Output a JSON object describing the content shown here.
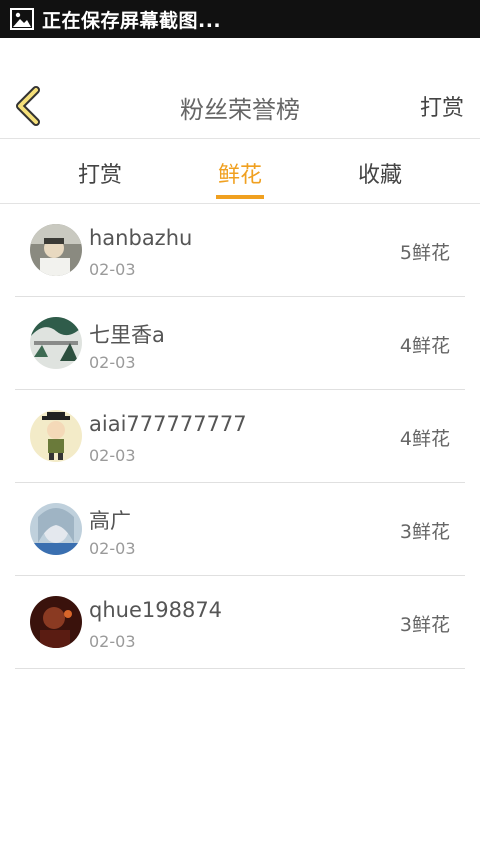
{
  "status_bar": {
    "text": "正在保存屏幕截图...",
    "icon": "image-icon"
  },
  "header": {
    "back_icon": "chevron-left-icon",
    "title": "粉丝荣誉榜",
    "right_action": "打赏"
  },
  "tabs": [
    {
      "label": "打赏",
      "active": false
    },
    {
      "label": "鲜花",
      "active": true
    },
    {
      "label": "收藏",
      "active": false
    }
  ],
  "colors": {
    "accent": "#f0a020",
    "status_bar": "#111111",
    "back_icon_fill": "#f5e07a"
  },
  "fans": [
    {
      "name": "hanbazhu",
      "date": "02-03",
      "count": "5鲜花"
    },
    {
      "name": "七里香a",
      "date": "02-03",
      "count": "4鲜花"
    },
    {
      "name": "aiai777777777",
      "date": "02-03",
      "count": "4鲜花"
    },
    {
      "name": "高广",
      "date": "02-03",
      "count": "3鲜花"
    },
    {
      "name": "qhue198874",
      "date": "02-03",
      "count": "3鲜花"
    }
  ]
}
